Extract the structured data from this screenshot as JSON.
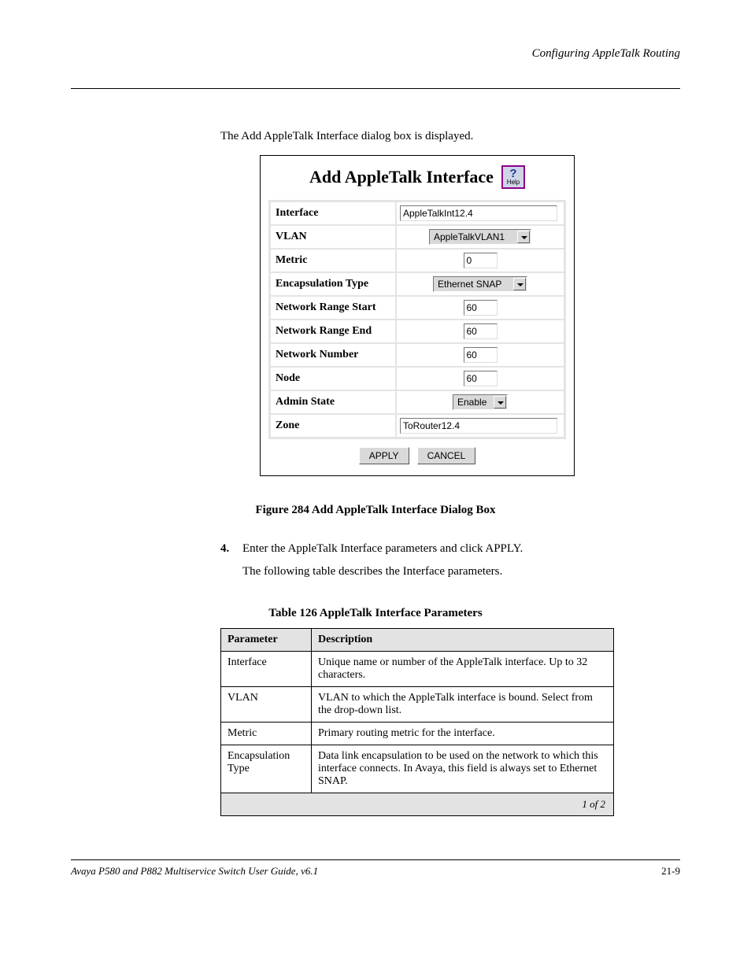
{
  "header_right": "Configuring AppleTalk Routing",
  "intro_text": "The Add AppleTalk Interface dialog box is displayed.",
  "dialog": {
    "title": "Add AppleTalk Interface",
    "help_label": "Help",
    "rows": {
      "interface": {
        "label": "Interface",
        "value": "AppleTalkInt12.4"
      },
      "vlan": {
        "label": "VLAN",
        "value": "AppleTalkVLAN1"
      },
      "metric": {
        "label": "Metric",
        "value": "0"
      },
      "encap": {
        "label": "Encapsulation Type",
        "value": "Ethernet SNAP"
      },
      "nrstart": {
        "label": "Network Range Start",
        "value": "60"
      },
      "nrend": {
        "label": "Network Range End",
        "value": "60"
      },
      "netnum": {
        "label": "Network Number",
        "value": "60"
      },
      "node": {
        "label": "Node",
        "value": "60"
      },
      "admin": {
        "label": "Admin State",
        "value": "Enable"
      },
      "zone": {
        "label": "Zone",
        "value": "ToRouter12.4"
      }
    },
    "buttons": {
      "apply": "APPLY",
      "cancel": "CANCEL"
    }
  },
  "figure_caption": "Figure 284   Add AppleTalk Interface Dialog Box",
  "followup_1": "Enter the AppleTalk Interface parameters and click APPLY.",
  "followup_2": "The following table describes the Interface parameters.",
  "table_caption": "Table 126   AppleTalk Interface Parameters",
  "param_table": {
    "headers": {
      "c1": "Parameter",
      "c2": "Description"
    },
    "rows": [
      {
        "name": "Interface",
        "desc": "Unique name or number of the AppleTalk interface. Up to 32 characters."
      },
      {
        "name": "VLAN",
        "desc": "VLAN to which the AppleTalk interface is bound. Select from the drop-down list."
      },
      {
        "name": "Metric",
        "desc": "Primary routing metric for the interface."
      },
      {
        "name": "Encapsulation Type",
        "desc": "Data link encapsulation to be used on the network to which this interface connects. In Avaya, this field is always set to Ethernet SNAP."
      }
    ],
    "sheet_footer": "1 of 2"
  },
  "footer": {
    "left": "Avaya P580 and P882 Multiservice Switch User Guide, v6.1",
    "right": "21-9"
  }
}
